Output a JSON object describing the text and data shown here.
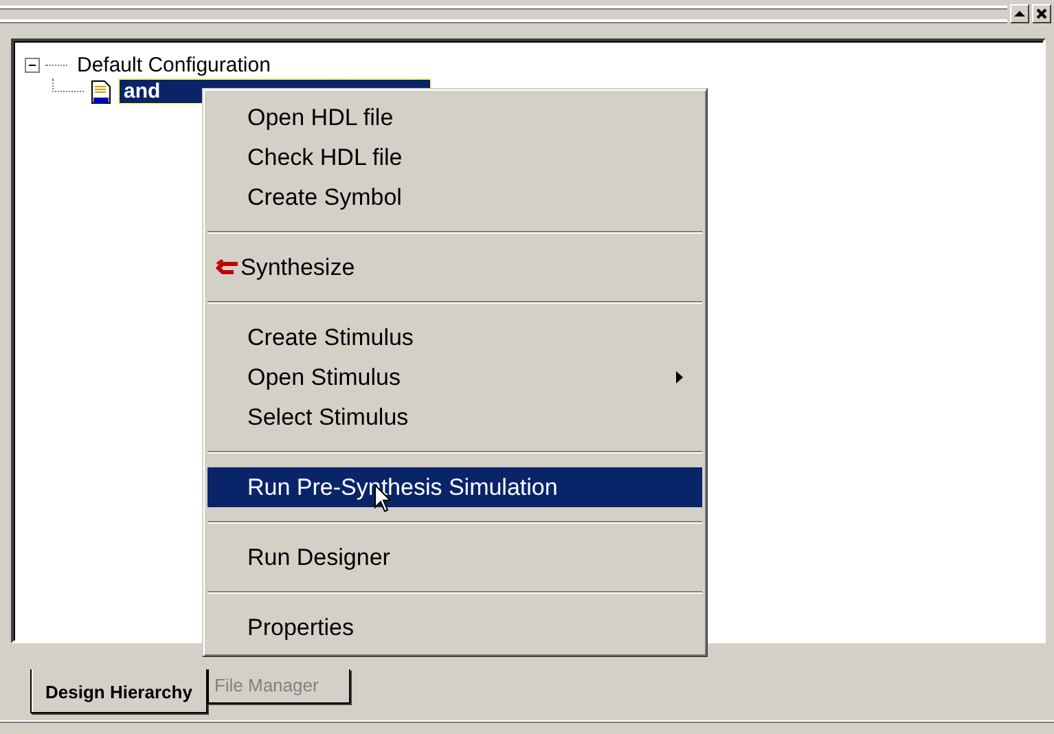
{
  "tree": {
    "label": "Default Configuration",
    "expanded": true,
    "children": [
      {
        "label": "and",
        "selected": true
      }
    ]
  },
  "context_menu": {
    "items": [
      {
        "kind": "item",
        "label": "Open HDL file",
        "selected": false,
        "submenu": false
      },
      {
        "kind": "item",
        "label": "Check HDL file",
        "selected": false,
        "submenu": false
      },
      {
        "kind": "item",
        "label": "Create Symbol",
        "selected": false,
        "submenu": false
      },
      {
        "kind": "separator"
      },
      {
        "kind": "icon_item",
        "label": "Synthesize",
        "selected": false,
        "submenu": false
      },
      {
        "kind": "separator"
      },
      {
        "kind": "item",
        "label": "Create Stimulus",
        "selected": false,
        "submenu": false
      },
      {
        "kind": "item",
        "label": "Open Stimulus",
        "selected": false,
        "submenu": true
      },
      {
        "kind": "item",
        "label": "Select Stimulus",
        "selected": false,
        "submenu": false
      },
      {
        "kind": "separator"
      },
      {
        "kind": "item",
        "label": "Run Pre-Synthesis Simulation",
        "selected": true,
        "submenu": false
      },
      {
        "kind": "separator"
      },
      {
        "kind": "item",
        "label": "Run Designer",
        "selected": false,
        "submenu": false
      },
      {
        "kind": "separator"
      },
      {
        "kind": "item",
        "label": "Properties",
        "selected": false,
        "submenu": false
      }
    ]
  },
  "tabs": [
    {
      "label": "Design Hierarchy",
      "selected": true
    },
    {
      "label": "File Manager",
      "selected": false
    }
  ]
}
